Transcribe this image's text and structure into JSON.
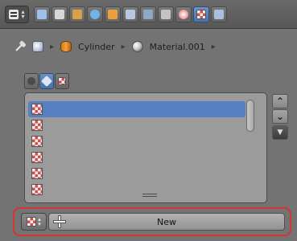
{
  "header": {
    "editor_type_icon": "properties-editor-icon",
    "tools": [
      {
        "name": "render-icon",
        "color": "#9fc0e8"
      },
      {
        "name": "render-layers-icon",
        "color": "#d8d8d8"
      },
      {
        "name": "scene-icon",
        "color": "#d9a04a"
      },
      {
        "name": "world-icon",
        "color": "#6fb3e8"
      },
      {
        "name": "object-icon",
        "color": "#e8a13c"
      },
      {
        "name": "constraints-icon",
        "color": "#b9c8dc"
      },
      {
        "name": "modifiers-icon",
        "color": "#8fa8c8"
      },
      {
        "name": "object-data-icon",
        "color": "#c3c3c3"
      },
      {
        "name": "material-icon",
        "color": "#e26060"
      },
      {
        "name": "texture-icon",
        "color": "#e8e8e8"
      },
      {
        "name": "particles-icon",
        "color": "#a8c0dd"
      }
    ],
    "active_tool": "texture-icon"
  },
  "breadcrumb": {
    "object": "Cylinder",
    "material": "Material.001"
  },
  "context_tabs": [
    {
      "name": "world-texture-tab",
      "color": "#6d6d6d"
    },
    {
      "name": "material-texture-tab",
      "color": "#d8e6f5"
    },
    {
      "name": "other-texture-tab",
      "color": "#e06060"
    }
  ],
  "slots": [
    {
      "label": "",
      "selected": true
    },
    {
      "label": "",
      "selected": false
    },
    {
      "label": "",
      "selected": false
    },
    {
      "label": "",
      "selected": false
    },
    {
      "label": "",
      "selected": false
    },
    {
      "label": "",
      "selected": false
    }
  ],
  "datablock": {
    "new_label": "New"
  },
  "colors": {
    "selection": "#5680c2",
    "highlight_frame": "#d4352f"
  }
}
